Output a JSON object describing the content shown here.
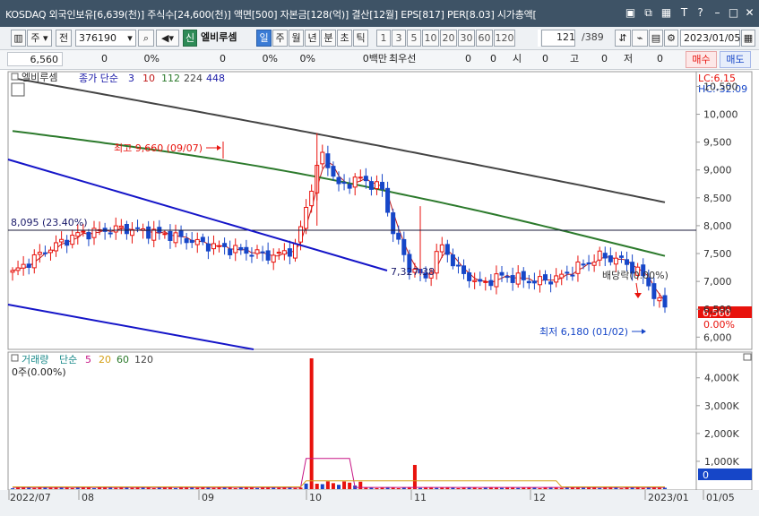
{
  "titlebar": {
    "text": "KOSDAQ 외국인보유[6,639(천)] 주식수[24,600(천)] 액면[500] 자본금[128(억)] 결산[12월] EPS[817] PER[8.03] 시가총액[",
    "icons": [
      "restore-icon",
      "popout-icon",
      "grid-icon",
      "text-icon",
      "help-icon",
      "minimize-icon",
      "maximize-icon",
      "close-icon"
    ]
  },
  "toolbar": {
    "type_label": "주",
    "market_label": "전",
    "code": "376190",
    "badge": "신",
    "stock_name": "엘비루셈",
    "periods": [
      "일",
      "주",
      "월",
      "년",
      "분",
      "초",
      "틱"
    ],
    "active_period": "일",
    "intervals": [
      "1",
      "3",
      "5",
      "10",
      "20",
      "30",
      "60",
      "120"
    ],
    "count": "121",
    "total": "/389",
    "date": "2023/01/05"
  },
  "quote": {
    "price": "6,560",
    "change": "0",
    "change_pct": "0%",
    "volume": "0",
    "volume_pct": "0%",
    "vol2_pct": "0%",
    "amount": "0백만",
    "best_label": "최우선",
    "best1": "0",
    "best2": "0",
    "open_label": "시",
    "open": "0",
    "high_label": "고",
    "high": "0",
    "low_label": "저",
    "low": "0",
    "buy_label": "매수",
    "sell_label": "매도"
  },
  "price_panel": {
    "stock_name": "엘비루셈",
    "indicator_label": "종가 단순",
    "ma_periods": [
      "3",
      "10",
      "112",
      "224",
      "448"
    ],
    "ma_colors": [
      "#1a1aa8",
      "#c01818",
      "#2c7a2c",
      "#444444",
      "#1a1aa8"
    ],
    "lc": "LC:6.15",
    "hc": "HC:-32.09",
    "high_annotation": "최고 9,660 (09/07)",
    "low_annotation": "최저 6,180 (01/02)",
    "line_label": "8,095 (23.40%)",
    "channel_label": "7,327.38",
    "dividend_label": "배당락(0.00%)",
    "current_price": "6,560",
    "current_pct": "0.00%",
    "y_axis": [
      "10,500",
      "10,000",
      "9,500",
      "9,000",
      "8,500",
      "8,000",
      "7,500",
      "7,000",
      "6,500",
      "6,000"
    ]
  },
  "volume_panel": {
    "label": "거래량",
    "indicator_label": "단순",
    "ma_periods": [
      "5",
      "20",
      "60",
      "120"
    ],
    "ma_colors": [
      "#c71585",
      "#d4a017",
      "#2c7a2c",
      "#444444"
    ],
    "sub_label": "0주(0.00%)",
    "y_axis": [
      "4,000K",
      "3,000K",
      "2,000K",
      "1,000K"
    ],
    "current": "0"
  },
  "x_axis": [
    "2022/07",
    "08",
    "09",
    "10",
    "11",
    "12",
    "2023/01",
    "01/05"
  ],
  "colors": {
    "up": "#e8120c",
    "down": "#1646c8",
    "ma5": "#c71585",
    "titlebar": "#3e5366",
    "buy": "#e8120c",
    "sell": "#1646c8"
  }
}
